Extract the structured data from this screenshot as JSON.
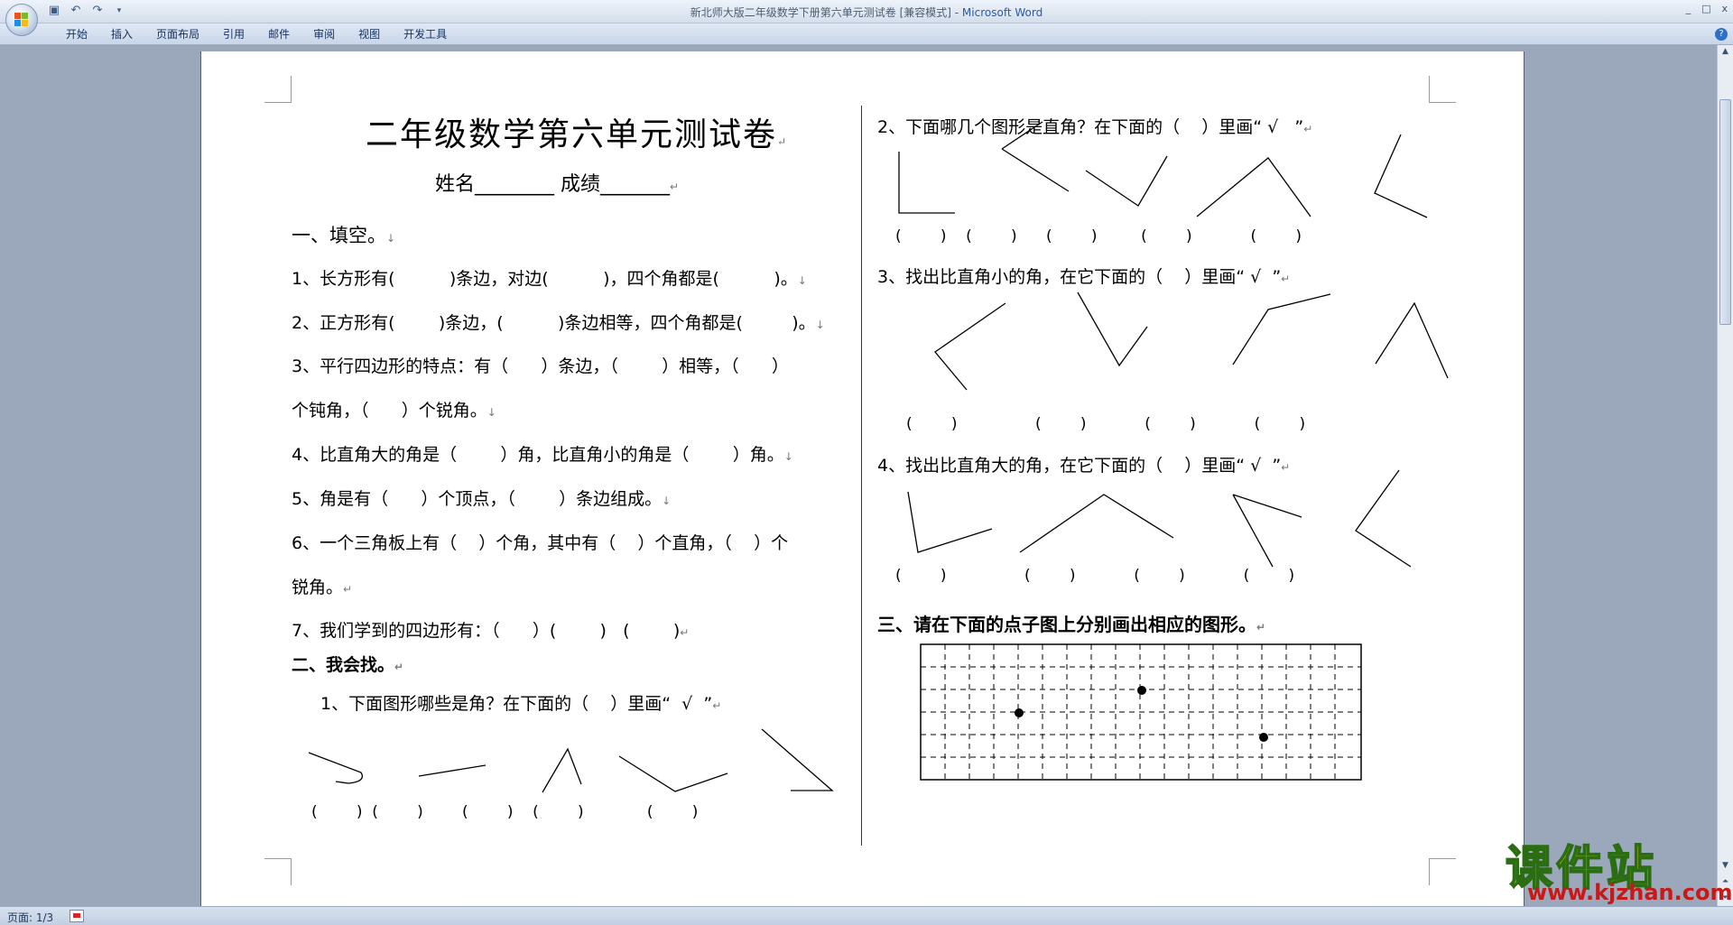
{
  "window": {
    "title": "新北师大版二年级数学下册第六单元测试卷 [兼容模式] - ",
    "app_name": "Microsoft Word",
    "controls": [
      "_",
      "□",
      "x"
    ]
  },
  "qat": {
    "save_icon": "save-icon",
    "undo_icon": "undo-icon",
    "redo_icon": "redo-icon",
    "customize_icon": "dropdown-icon"
  },
  "ribbon": {
    "tabs": [
      "开始",
      "插入",
      "页面布局",
      "引用",
      "邮件",
      "审阅",
      "视图",
      "开发工具"
    ],
    "help": "?"
  },
  "document": {
    "title": "二年级数学第六单元测试卷",
    "name_line": "姓名________   成绩_______",
    "section1": "一、填空。",
    "q1": "1、长方形有(          )条边，对边(          )，四个角都是(          )。",
    "q2": "2、正方形有(        )条边，(          )条边相等，四个角都是(         )。",
    "q3a": "3、平行四边形的特点：有（      ）条边，（        ）相等，（      ）",
    "q3b": "个钝角，（      ）个锐角。",
    "q4": "4、比直角大的角是（        ）角，比直角小的角是（        ）角。",
    "q5": "5、角是有（      ）个顶点，（        ）条边组成。",
    "q6a": "6、一个三角板上有（    ）个角，其中有（    ）个直角，（    ）个",
    "q6b": "锐角。",
    "q7": "7、我们学到的四边形有：（      ）(        )   (        )",
    "section2": "二、我会找。",
    "s2q1": "1、下面图形哪些是角？在下面的（    ）里画“  √  ”",
    "s2q1_parens": "(        )  (        )        (        )    (        )             (        )",
    "r_q2": "2、下面哪几个图形是直角？在下面的（    ）里画“ √   ”",
    "r_q2_parens": "(        )    (        )      (        )         (        )            (        )",
    "r_q3": "3、找出比直角小的角，在它下面的（    ）里画“ √  ”",
    "r_q3_parens": "(        )                (        )            (        )            (        )",
    "r_q4": "4、找出比直角大的角，在它下面的（    ）里画“ √  ”",
    "r_q4_parens": "(        )                (        )            (        )            (        )",
    "section3": "三、请在下面的点子图上分别画出相应的图形。",
    "para_mark": "↵",
    "arrow_mark": "↓"
  },
  "statusbar": {
    "page": "页面: 1/3"
  },
  "watermark": {
    "big": "课件站",
    "url": "www.kjzhan.com"
  }
}
